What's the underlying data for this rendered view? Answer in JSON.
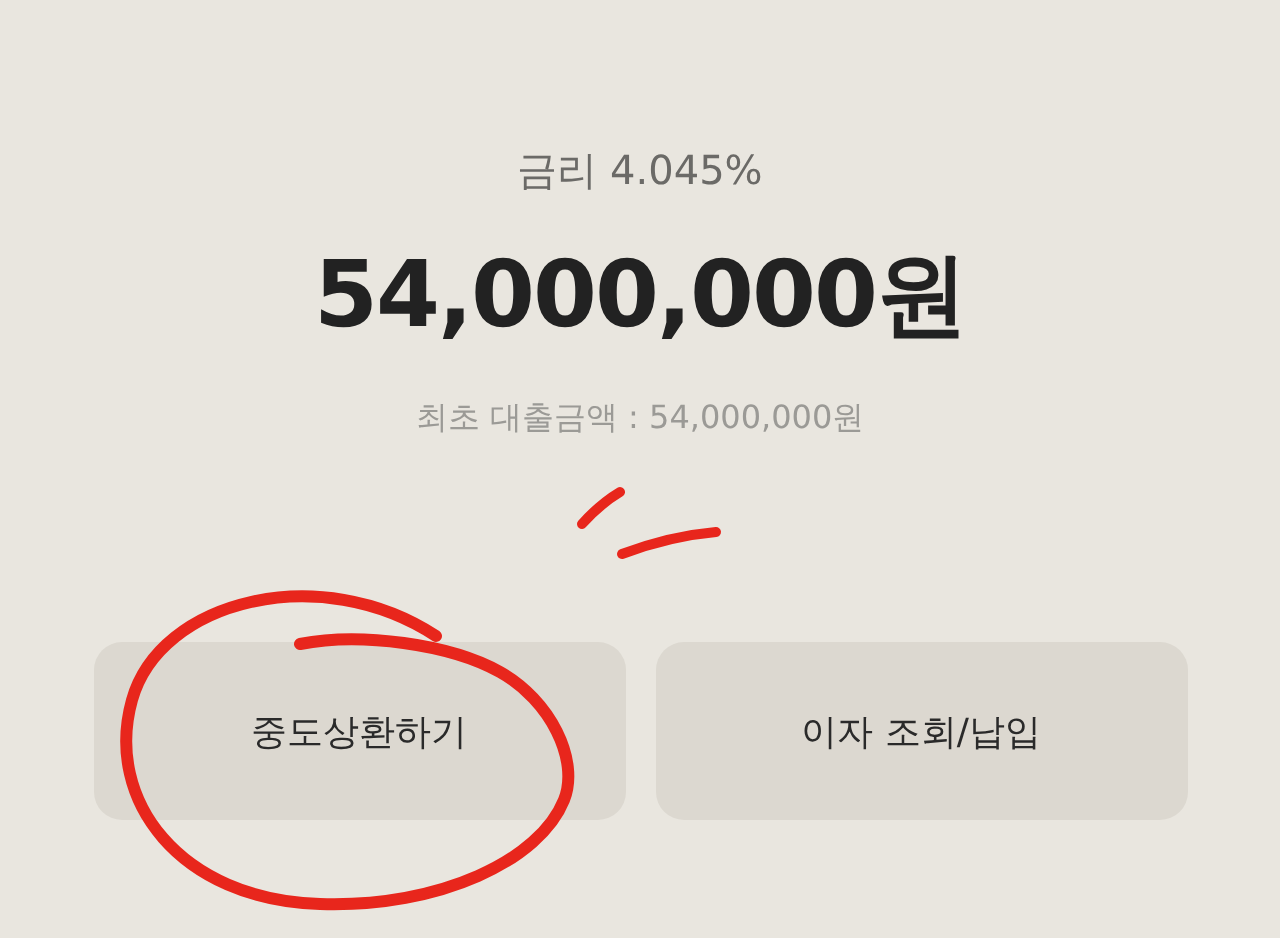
{
  "interest_rate": "금리 4.045%",
  "balance": "54,000,000원",
  "initial_loan": "최초 대출금액 : 54,000,000원",
  "buttons": [
    {
      "label": "중도상환하기"
    },
    {
      "label": "이자 조회/납입"
    }
  ]
}
